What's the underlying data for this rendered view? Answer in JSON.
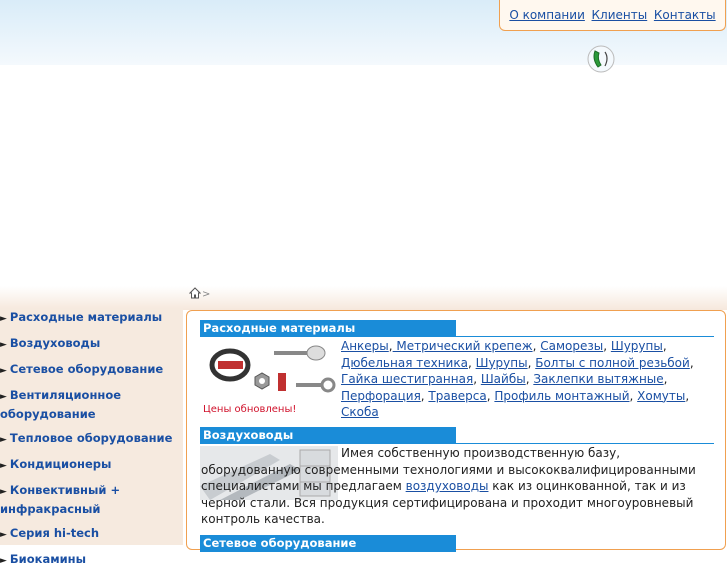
{
  "topnav": {
    "items": [
      "О компании",
      "Клиенты",
      "Контакты"
    ]
  },
  "breadcrumb": {
    "separator": ">"
  },
  "sidebar": {
    "items": [
      {
        "label": "Расходные материалы"
      },
      {
        "label": "Воздуховоды"
      },
      {
        "label": "Сетевое оборудование"
      },
      {
        "label": "Вентиляционное оборудование"
      },
      {
        "label": "Тепловое оборудование"
      },
      {
        "label": "Кондиционеры"
      },
      {
        "label": "Конвективный + инфракрасный"
      },
      {
        "label": "Серия hi-tech"
      },
      {
        "label": "Биокамины"
      }
    ],
    "arrow": "►"
  },
  "sections": {
    "consumables": {
      "title": "Расходные материалы",
      "links": [
        "Анкеры",
        " Метрический крепеж",
        "Саморезы",
        "Шурупы",
        "Дюбельная техника",
        "Шурупы",
        "Болты с полной резьбой",
        "Гайка шестигранная",
        "Шайбы",
        "Заклепки вытяжные",
        "Перфорация",
        "Траверса",
        "Профиль монтажный",
        "Хомуты",
        "Скоба"
      ],
      "prices_note": "Цены обновлены!"
    },
    "ducts": {
      "title": "Воздуховоды",
      "text_before": "Имея собственную производственную базу, оборудованную современными технологиями и высококвалифицированными специалистами мы предлагаем ",
      "link": "воздуховоды",
      "text_after": " как из оцинкованной, так и из черной стали. Вся продукция сертифицирована и проходит многоуровневый контроль качества."
    },
    "network": {
      "title": "Сетевое оборудование"
    }
  },
  "colors": {
    "accent": "#1a8cd8",
    "border": "#f0a050",
    "link": "#1a4fa3",
    "sidebar_bg": "#f6eadf",
    "price_note": "#d0102a"
  }
}
